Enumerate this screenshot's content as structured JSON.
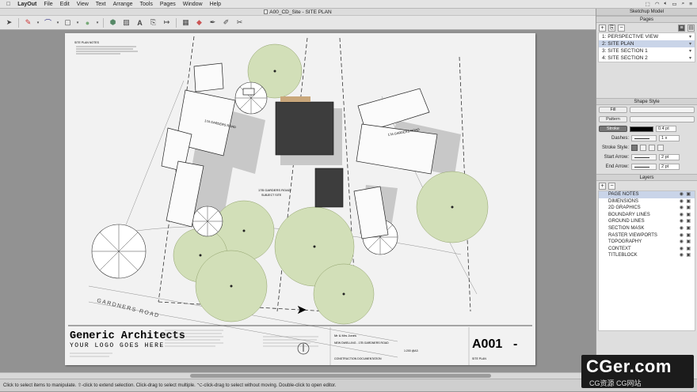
{
  "menubar": {
    "apple": "",
    "app": "LayOut",
    "items": [
      "File",
      "Edit",
      "View",
      "Text",
      "Arrange",
      "Tools",
      "Pages",
      "Window",
      "Help"
    ]
  },
  "window": {
    "title": "A00_CD_Site - SITE PLAN"
  },
  "tray": {
    "title": "Sketchup Model"
  },
  "pages_panel": {
    "title": "Pages",
    "items": [
      {
        "label": "1:  PERSPECTIVE VIEW",
        "selected": false
      },
      {
        "label": "2:  SITE PLAN",
        "selected": true
      },
      {
        "label": "3:  SITE SECTION 1",
        "selected": false
      },
      {
        "label": "4:  SITE SECTION 2",
        "selected": false
      }
    ]
  },
  "shape_style": {
    "title": "Shape Style",
    "fill_label": "Fill",
    "pattern_label": "Pattern",
    "stroke_label": "Stroke",
    "stroke_width": "0.4 pt",
    "dashes_label": "Dashes:",
    "dash_scale": "1 x",
    "stroke_style_label": "Stroke Style:",
    "start_arrow_label": "Start Arrow:",
    "start_arrow_size": "2 pt",
    "end_arrow_label": "End Arrow:",
    "end_arrow_size": "2 pt"
  },
  "layers_panel": {
    "title": "Layers",
    "add": "+",
    "remove": "−",
    "items": [
      {
        "label": "PAGE NOTES",
        "selected": true
      },
      {
        "label": "DIMENSIONS",
        "selected": false
      },
      {
        "label": "2D GRAPHICS",
        "selected": false
      },
      {
        "label": "BOUNDARY LINES",
        "selected": false
      },
      {
        "label": "GROUND LINES",
        "selected": false
      },
      {
        "label": "SECTION MASK",
        "selected": false
      },
      {
        "label": "RASTER VIEWPORTS",
        "selected": false
      },
      {
        "label": "TOPOGRAPHY",
        "selected": false
      },
      {
        "label": "CONTEXT",
        "selected": false
      },
      {
        "label": "TITLEBLOCK",
        "selected": false
      }
    ]
  },
  "drawing": {
    "road_label_1": "17A GARDERS ROAD",
    "road_label_2": "17A GARDERS ROAD",
    "subject_label": "17B GARDERS ROAD",
    "subject_sub": "SUBJECT SITE",
    "street_name": "GARDNERS ROAD",
    "notes_title": "SITE PLAN NOTES"
  },
  "title_block": {
    "company": "Generic Architects",
    "tagline": "YOUR LOGO GOES HERE",
    "sheet_number": "A001",
    "sheet_rev": "-",
    "client": "Mr & Mrs Jones",
    "project": "NEW DWELLING - 17B GARDNERS ROAD",
    "purpose": "CONSTRUCTION DOCUMENTATION",
    "sheet_title": "SITE PLAN",
    "scale": "1:200 @A3"
  },
  "status": {
    "text": "Click to select items to manipulate. ⇧-click to extend selection. Click-drag to select multiple. ⌥-click-drag to select without moving. Double-click to open editor."
  },
  "watermark": {
    "main": "CGer.com",
    "sub": "CG资源  CG网站"
  }
}
